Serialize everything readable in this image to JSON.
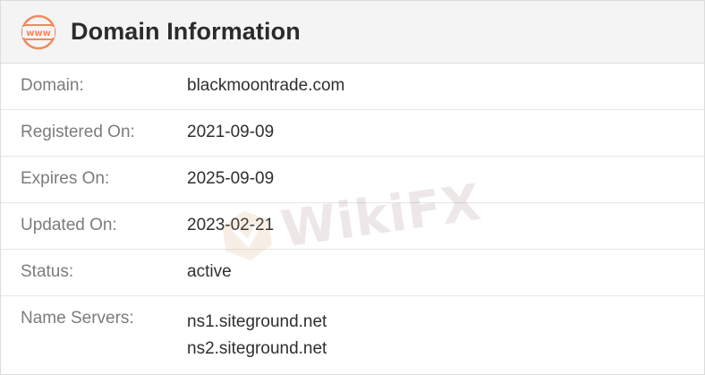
{
  "header": {
    "title": "Domain Information",
    "icon_text": "www",
    "icon_color": "#f08a5d"
  },
  "rows": [
    {
      "label": "Domain:",
      "value": "blackmoontrade.com"
    },
    {
      "label": "Registered On:",
      "value": "2021-09-09"
    },
    {
      "label": "Expires On:",
      "value": "2025-09-09"
    },
    {
      "label": "Updated On:",
      "value": "2023-02-21"
    },
    {
      "label": "Status:",
      "value": "active"
    }
  ],
  "name_servers": {
    "label": "Name Servers:",
    "values": [
      "ns1.siteground.net",
      "ns2.siteground.net"
    ]
  },
  "watermark": {
    "text": "WikiFX"
  }
}
